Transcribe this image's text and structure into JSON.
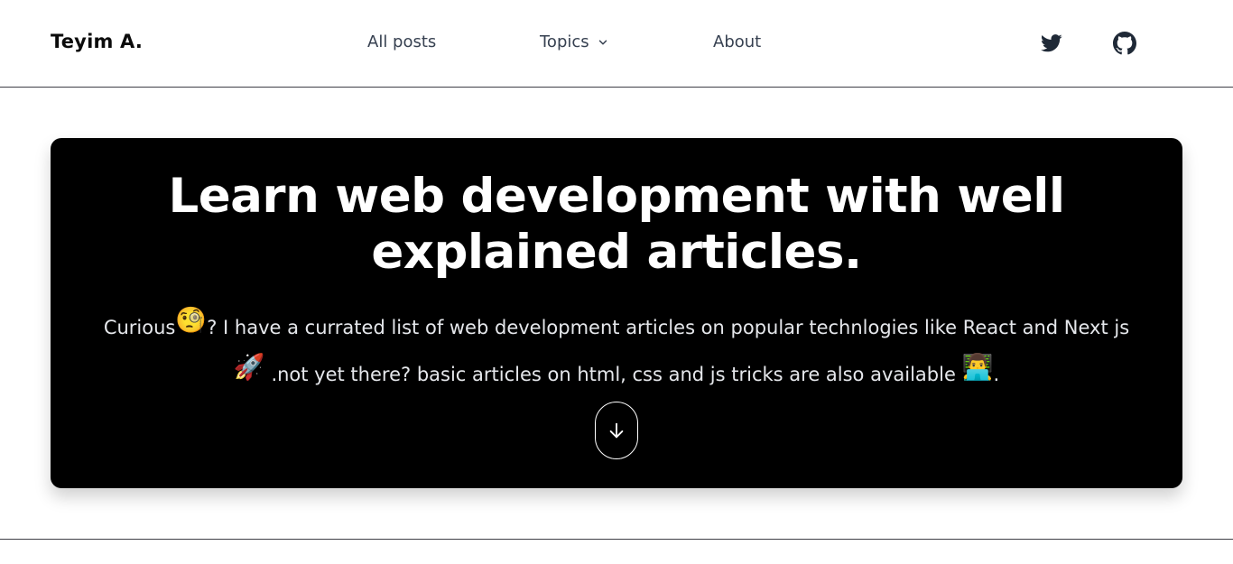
{
  "nav": {
    "brand": "Teyim A.",
    "links": {
      "all_posts": "All posts",
      "topics": "Topics",
      "about": "About"
    },
    "icons": [
      "twitter-icon",
      "github-icon",
      "chevron-down-icon"
    ]
  },
  "hero": {
    "title": "Learn web development with well explained articles.",
    "text_1": "Curious",
    "emoji_1": "🧐",
    "text_2": "? I have a currated list of web development articles on popular technlogies like React and Next js",
    "emoji_2": "🚀",
    "text_3": ".not yet there? basic articles on html, css and js tricks are also available",
    "emoji_3": "👨‍💻",
    "text_4": ".",
    "scroll_icon": "arrow-down-icon"
  },
  "colors": {
    "hero_bg": "#000000",
    "nav_text": "#374151",
    "brand_text": "#0b0b0b",
    "divider": "#3f3f46"
  }
}
